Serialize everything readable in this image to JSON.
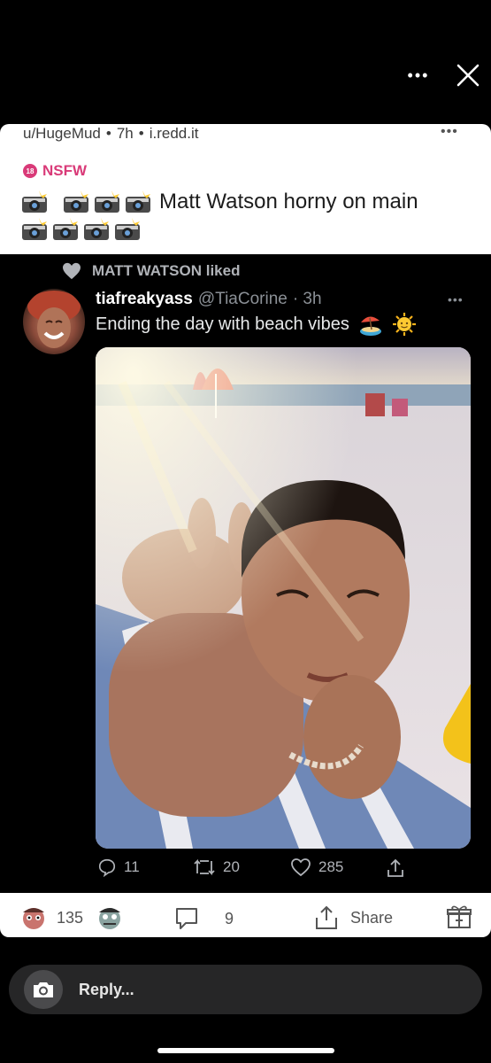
{
  "topbar": {
    "more_label": "•••",
    "close_icon": "close-icon"
  },
  "post": {
    "author": "u/HugeMud",
    "age": "7h",
    "domain": "i.redd.it",
    "more_label": "•••",
    "nsfw_badge": "18",
    "nsfw_label": "NSFW",
    "title": "Matt Watson horny on main",
    "title_icons": "camera-flash-icon"
  },
  "tweet": {
    "liked_by": "MATT WATSON liked",
    "name": "tiafreakyass",
    "handle": "@TiaCorine",
    "age": "· 3h",
    "more_label": "•••",
    "text": "Ending the day with beach vibes",
    "replies": "11",
    "retweets": "20",
    "likes": "285"
  },
  "footer": {
    "votes": "135",
    "comments": "9",
    "share_label": "Share"
  },
  "reply": {
    "label": "Reply..."
  },
  "colors": {
    "nsfw": "#d93a78",
    "background": "#000000",
    "card": "#ffffff"
  }
}
